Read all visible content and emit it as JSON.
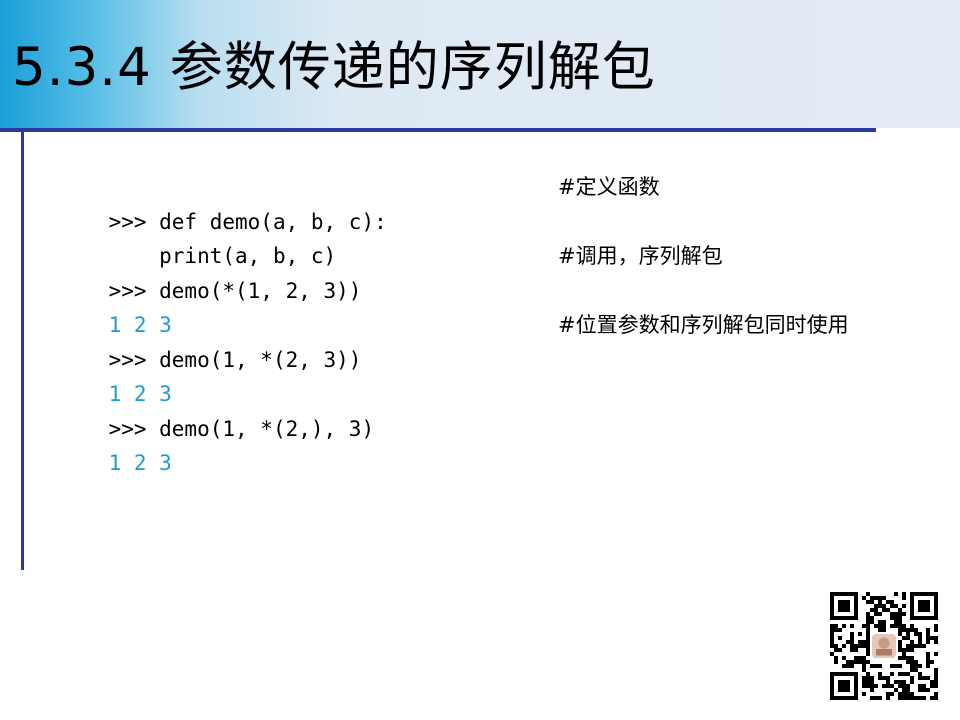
{
  "slide": {
    "title": "5.3.4 参数传递的序列解包"
  },
  "code": [
    {
      "kind": "input",
      "text": ">>> def demo(a, b, c):",
      "comment": "#定义函数"
    },
    {
      "kind": "input",
      "text": "    print(a, b, c)",
      "comment": ""
    },
    {
      "kind": "input",
      "text": ">>> demo(*(1, 2, 3))",
      "comment": "#调用，序列解包"
    },
    {
      "kind": "output",
      "text": "1 2 3",
      "comment": ""
    },
    {
      "kind": "input",
      "text": ">>> demo(1, *(2, 3))",
      "comment": "#位置参数和序列解包同时使用"
    },
    {
      "kind": "output",
      "text": "1 2 3",
      "comment": ""
    },
    {
      "kind": "input",
      "text": ">>> demo(1, *(2,), 3)",
      "comment": ""
    },
    {
      "kind": "output",
      "text": "1 2 3",
      "comment": ""
    }
  ],
  "colors": {
    "output": "#1e9ad6",
    "accent": "#2b3aa0",
    "title_gradient_start": "#1a9fd8",
    "title_gradient_end": "#e4ecf5"
  },
  "qr_code": {
    "icon": "qr-code-icon"
  }
}
